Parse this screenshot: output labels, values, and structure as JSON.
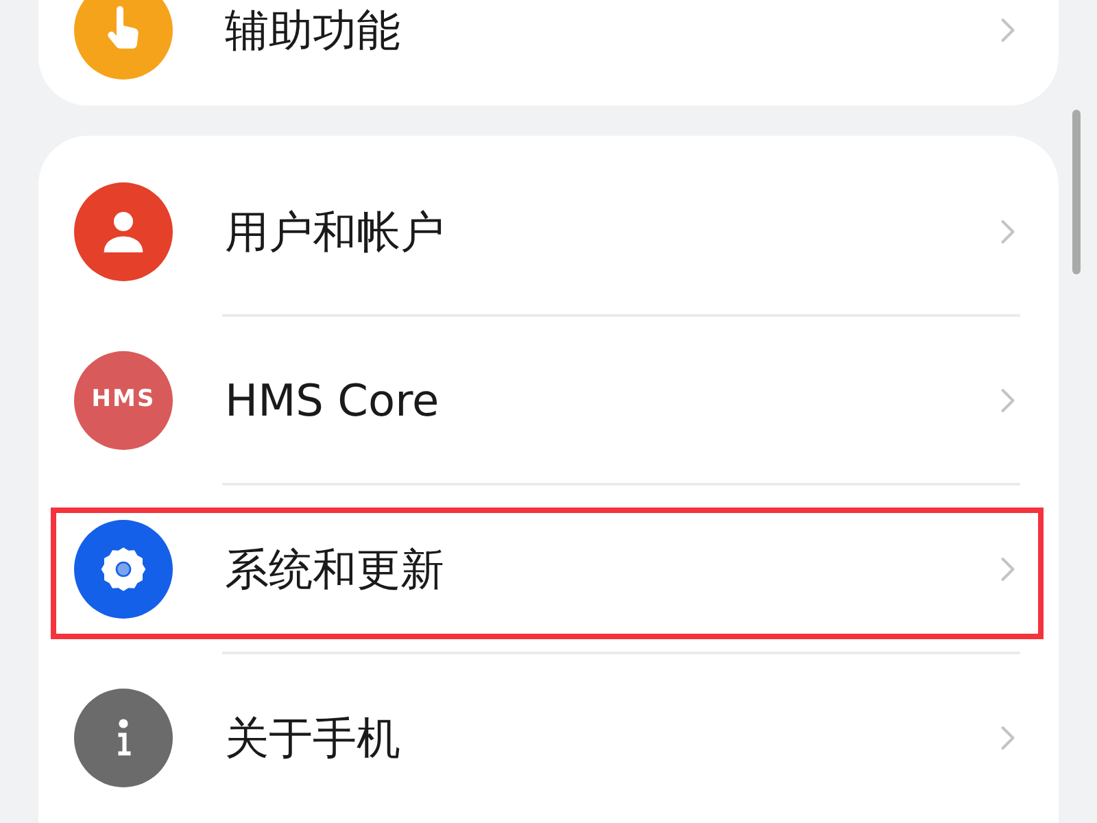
{
  "groups": [
    {
      "items": [
        {
          "label": "辅助功能",
          "kind": "hand",
          "highlighted": false
        }
      ]
    },
    {
      "items": [
        {
          "label": "用户和帐户",
          "kind": "person",
          "highlighted": false
        },
        {
          "label": "HMS Core",
          "kind": "hms",
          "icon_text": "HMS",
          "highlighted": false
        },
        {
          "label": "系统和更新",
          "kind": "gear",
          "highlighted": true
        },
        {
          "label": "关于手机",
          "kind": "info",
          "highlighted": false
        }
      ]
    }
  ]
}
